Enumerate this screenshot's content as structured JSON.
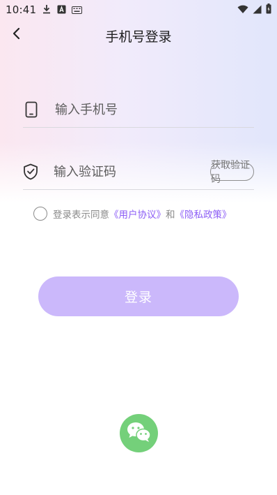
{
  "status_bar": {
    "time": "10:41",
    "left_icons": [
      "download-icon",
      "keyboard-a-icon",
      "keyboard-icon"
    ],
    "right_icons": [
      "wifi-icon",
      "signal-icon",
      "battery-icon"
    ]
  },
  "header": {
    "title": "手机号登录",
    "back_icon": "chevron-left-icon"
  },
  "form": {
    "phone": {
      "icon": "phone-icon",
      "placeholder": "输入手机号",
      "value": ""
    },
    "code": {
      "icon": "shield-check-icon",
      "placeholder": "输入验证码",
      "value": "",
      "get_code_label": "获取验证码"
    }
  },
  "agreement": {
    "checked": false,
    "prefix": "登录表示同意",
    "user_agreement": "《用户协议》",
    "conjunction": "和",
    "privacy_policy": "《隐私政策》"
  },
  "login_button": {
    "label": "登录"
  },
  "social_login": {
    "wechat_icon": "wechat-icon"
  },
  "colors": {
    "accent": "#8b5cf6",
    "login_button_bg": "#cbb8fb",
    "wechat_green": "#74d07a"
  }
}
